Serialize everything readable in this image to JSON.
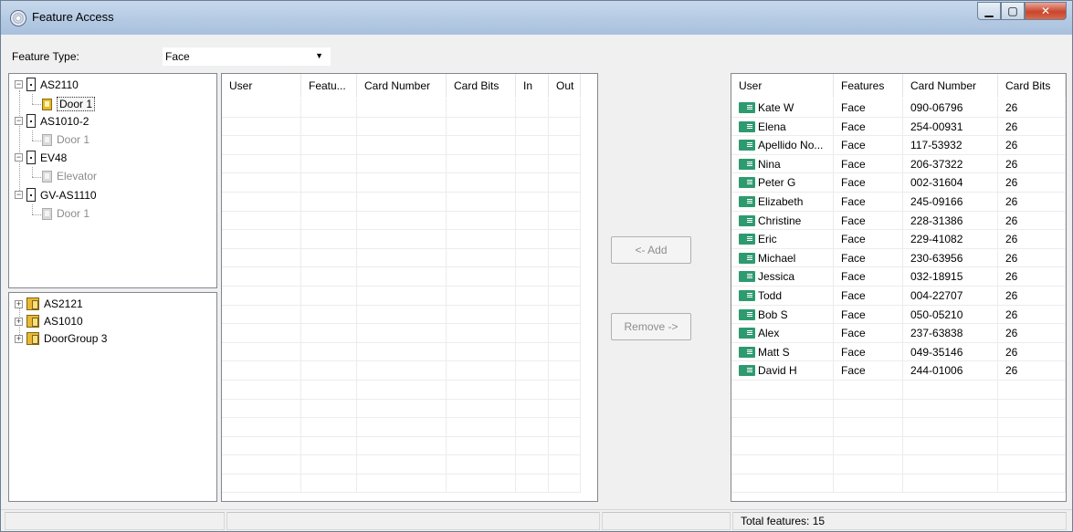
{
  "window": {
    "title": "Feature Access",
    "title_icon": "fingerprint-swirl-icon"
  },
  "feature_type": {
    "label": "Feature Type:",
    "value": "Face"
  },
  "controller_tree": [
    {
      "label": "AS2110",
      "child": "Door 1",
      "child_selected": true,
      "child_enabled": true
    },
    {
      "label": "AS1010-2",
      "child": "Door 1",
      "child_selected": false,
      "child_enabled": false
    },
    {
      "label": "EV48",
      "child": "Elevator",
      "child_selected": false,
      "child_enabled": false
    },
    {
      "label": "GV-AS1110",
      "child": "Door 1",
      "child_selected": false,
      "child_enabled": false
    }
  ],
  "group_tree": [
    {
      "label": "AS2121"
    },
    {
      "label": "AS1010"
    },
    {
      "label": "DoorGroup 3"
    }
  ],
  "access_table": {
    "columns": [
      "User",
      "Featu...",
      "Card Number",
      "Card Bits",
      "In",
      "Out"
    ]
  },
  "buttons": {
    "add": "<- Add",
    "remove": "Remove ->"
  },
  "user_table": {
    "columns": [
      "User",
      "Features",
      "Card Number",
      "Card Bits"
    ],
    "rows": [
      {
        "user": "Kate W",
        "features": "Face",
        "card_number": "090-06796",
        "card_bits": "26"
      },
      {
        "user": "Elena",
        "features": "Face",
        "card_number": "254-00931",
        "card_bits": "26"
      },
      {
        "user": "Apellido No...",
        "features": "Face",
        "card_number": "117-53932",
        "card_bits": "26"
      },
      {
        "user": "Nina",
        "features": "Face",
        "card_number": "206-37322",
        "card_bits": "26"
      },
      {
        "user": "Peter G",
        "features": "Face",
        "card_number": "002-31604",
        "card_bits": "26"
      },
      {
        "user": "Elizabeth",
        "features": "Face",
        "card_number": "245-09166",
        "card_bits": "26"
      },
      {
        "user": "Christine",
        "features": "Face",
        "card_number": "228-31386",
        "card_bits": "26"
      },
      {
        "user": "Eric",
        "features": "Face",
        "card_number": "229-41082",
        "card_bits": "26"
      },
      {
        "user": "Michael",
        "features": "Face",
        "card_number": "230-63956",
        "card_bits": "26"
      },
      {
        "user": "Jessica",
        "features": "Face",
        "card_number": "032-18915",
        "card_bits": "26"
      },
      {
        "user": "Todd",
        "features": "Face",
        "card_number": "004-22707",
        "card_bits": "26"
      },
      {
        "user": "Bob S",
        "features": "Face",
        "card_number": "050-05210",
        "card_bits": "26"
      },
      {
        "user": "Alex",
        "features": "Face",
        "card_number": "237-63838",
        "card_bits": "26"
      },
      {
        "user": "Matt S",
        "features": "Face",
        "card_number": "049-35146",
        "card_bits": "26"
      },
      {
        "user": "David H",
        "features": "Face",
        "card_number": "244-01006",
        "card_bits": "26"
      }
    ]
  },
  "status_bar": {
    "total_features": "Total features: 15"
  }
}
